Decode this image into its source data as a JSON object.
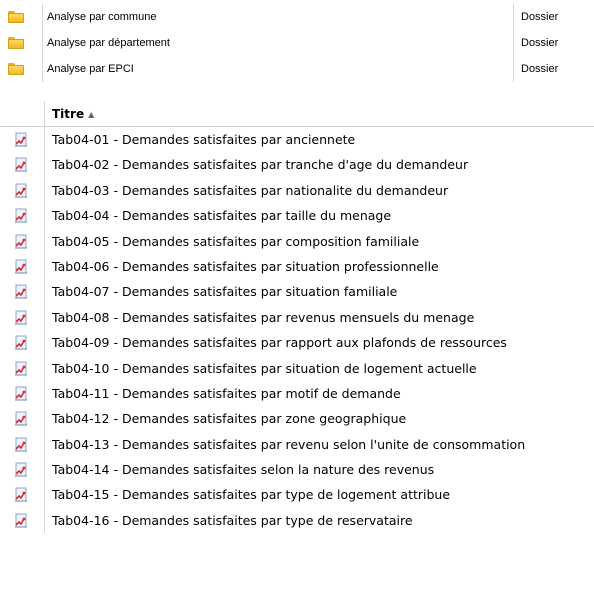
{
  "folders": [
    {
      "name": "Analyse par commune",
      "type": "Dossier",
      "icon": "folder-icon"
    },
    {
      "name": "Analyse par département",
      "type": "Dossier",
      "icon": "folder-icon"
    },
    {
      "name": "Analyse par EPCI",
      "type": "Dossier",
      "icon": "folder-icon"
    }
  ],
  "reports": {
    "header": {
      "title": "Titre",
      "sort_icon": "▲"
    },
    "items": [
      {
        "label": "Tab04-01 - Demandes satisfaites par anciennete",
        "icon": "report-icon"
      },
      {
        "label": "Tab04-02 - Demandes satisfaites par tranche d'age du demandeur",
        "icon": "report-icon"
      },
      {
        "label": "Tab04-03 - Demandes satisfaites par nationalite du demandeur",
        "icon": "report-icon"
      },
      {
        "label": "Tab04-04 - Demandes satisfaites par taille du menage",
        "icon": "report-icon"
      },
      {
        "label": "Tab04-05 - Demandes satisfaites par composition familiale",
        "icon": "report-icon"
      },
      {
        "label": "Tab04-06 - Demandes satisfaites par situation professionnelle",
        "icon": "report-icon"
      },
      {
        "label": "Tab04-07 - Demandes satisfaites par situation familiale",
        "icon": "report-icon"
      },
      {
        "label": "Tab04-08 - Demandes satisfaites par revenus mensuels du menage",
        "icon": "report-icon"
      },
      {
        "label": "Tab04-09 - Demandes satisfaites par rapport aux plafonds de ressources",
        "icon": "report-icon"
      },
      {
        "label": "Tab04-10 - Demandes satisfaites par situation de logement actuelle",
        "icon": "report-icon"
      },
      {
        "label": "Tab04-11 - Demandes satisfaites par motif de demande",
        "icon": "report-icon"
      },
      {
        "label": "Tab04-12 - Demandes satisfaites par zone geographique",
        "icon": "report-icon"
      },
      {
        "label": "Tab04-13 - Demandes satisfaites par revenu selon l'unite de consommation",
        "icon": "report-icon"
      },
      {
        "label": "Tab04-14 - Demandes satisfaites selon la nature des revenus",
        "icon": "report-icon"
      },
      {
        "label": "Tab04-15 - Demandes satisfaites par type de logement attribue",
        "icon": "report-icon"
      },
      {
        "label": "Tab04-16 - Demandes satisfaites par type de reservataire",
        "icon": "report-icon"
      }
    ]
  }
}
